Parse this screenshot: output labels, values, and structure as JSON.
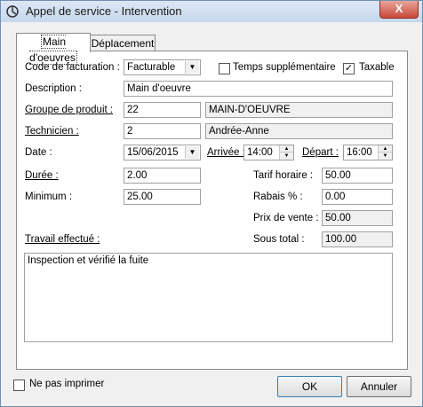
{
  "window": {
    "title": "Appel de service - Intervention",
    "close_label": "X"
  },
  "tabs": [
    {
      "label": "Main d'oeuvres",
      "active": true
    },
    {
      "label": "Déplacement",
      "active": false
    }
  ],
  "form": {
    "code_facturation": {
      "label": "Code de facturation :",
      "value": "Facturable"
    },
    "temps_supplementaire": {
      "label": "Temps supplémentaire",
      "checked": false
    },
    "taxable": {
      "label": "Taxable",
      "checked": true
    },
    "description": {
      "label": "Description :",
      "value": "Main d'oeuvre"
    },
    "groupe_produit": {
      "label": "Groupe de produit :",
      "code": "22",
      "name": "MAIN-D'OEUVRE"
    },
    "technicien": {
      "label": "Technicien :",
      "code": "2",
      "name": "Andrée-Anne"
    },
    "date": {
      "label": "Date :",
      "value": "15/06/2015"
    },
    "arrivee": {
      "label": "Arrivée :",
      "value": "14:00"
    },
    "depart": {
      "label": "Départ :",
      "value": "16:00"
    },
    "duree": {
      "label": "Durée :",
      "value": "2.00"
    },
    "minimum": {
      "label": "Minimum :",
      "value": "25.00"
    },
    "tarif_horaire": {
      "label": "Tarif horaire :",
      "value": "50.00"
    },
    "rabais": {
      "label": "Rabais % :",
      "value": "0.00"
    },
    "prix_vente": {
      "label": "Prix de vente :",
      "value": "50.00"
    },
    "sous_total": {
      "label": "Sous total :",
      "value": "100.00"
    },
    "travail": {
      "label": "Travail effectué :",
      "value": "Inspection et vérifié la fuite"
    }
  },
  "footer": {
    "ne_pas_imprimer": {
      "label": "Ne pas imprimer",
      "checked": false
    },
    "ok_label": "OK",
    "cancel_label": "Annuler"
  }
}
